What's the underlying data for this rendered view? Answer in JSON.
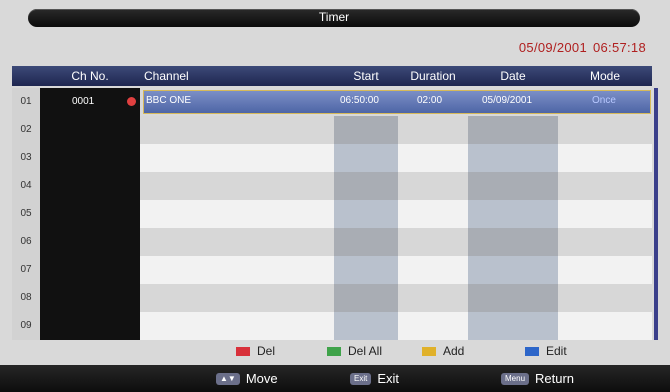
{
  "window": {
    "title": "Timer"
  },
  "clock": {
    "date": "05/09/2001",
    "time": "06:57:18"
  },
  "table": {
    "headers": {
      "chno": "Ch No.",
      "channel": "Channel",
      "start": "Start",
      "duration": "Duration",
      "date": "Date",
      "mode": "Mode"
    },
    "rows": [
      {
        "num": "01",
        "chno": "0001",
        "channel": "BBC ONE",
        "start": "06:50:00",
        "duration": "02:00",
        "date": "05/09/2001",
        "mode": "Once"
      },
      {
        "num": "02"
      },
      {
        "num": "03"
      },
      {
        "num": "04"
      },
      {
        "num": "05"
      },
      {
        "num": "06"
      },
      {
        "num": "07"
      },
      {
        "num": "08"
      },
      {
        "num": "09"
      }
    ]
  },
  "legend": {
    "del": "Del",
    "del_all": "Del All",
    "add": "Add",
    "edit": "Edit",
    "colors": {
      "del": "#d8303a",
      "del_all": "#3fa34a",
      "add": "#e0b12a",
      "edit": "#2d66c9"
    }
  },
  "footer": {
    "move_key": "▲▼",
    "move": "Move",
    "exit_key": "Exit",
    "exit": "Exit",
    "menu_key": "Menu",
    "return": "Return"
  }
}
